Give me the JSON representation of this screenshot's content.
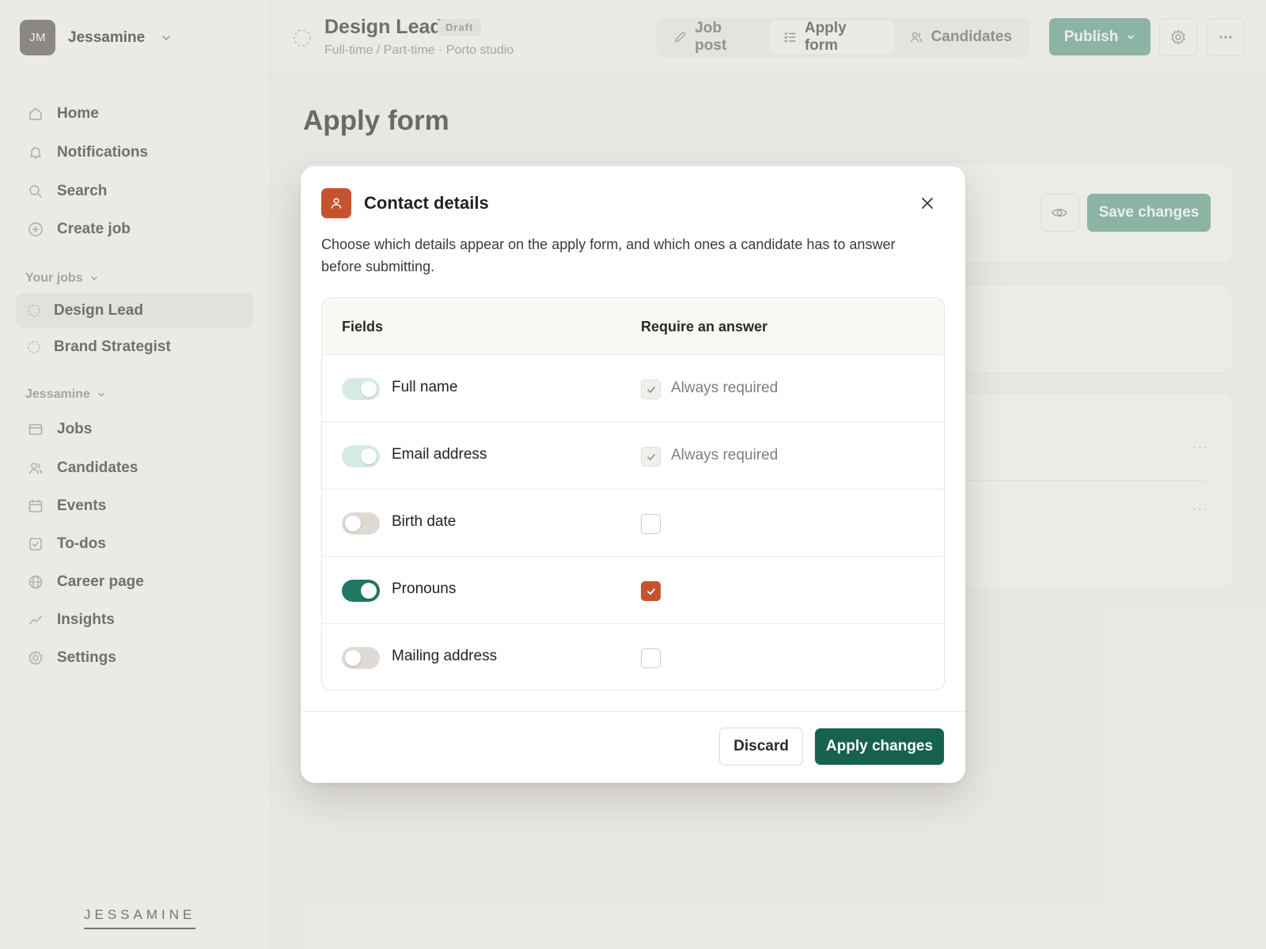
{
  "sidebar": {
    "account": {
      "initials": "JM",
      "name": "Jessamine"
    },
    "nav": [
      {
        "label": "Home",
        "icon": "home-icon"
      },
      {
        "label": "Notifications",
        "icon": "bell-icon"
      },
      {
        "label": "Search",
        "icon": "search-icon"
      },
      {
        "label": "Create job",
        "icon": "plus-circle-icon"
      }
    ],
    "your_jobs_label": "Your jobs",
    "jobs": [
      {
        "label": "Design Lead",
        "active": true
      },
      {
        "label": "Brand Strategist",
        "active": false
      }
    ],
    "workspace_label": "Jessamine",
    "workspace_nav": [
      {
        "label": "Jobs",
        "icon": "briefcase-icon"
      },
      {
        "label": "Candidates",
        "icon": "people-icon"
      },
      {
        "label": "Events",
        "icon": "calendar-icon"
      },
      {
        "label": "To-dos",
        "icon": "checklist-icon"
      },
      {
        "label": "Career page",
        "icon": "globe-icon"
      },
      {
        "label": "Insights",
        "icon": "chart-line-icon"
      },
      {
        "label": "Settings",
        "icon": "gear-icon"
      }
    ],
    "brand": "JESSAMINE"
  },
  "header": {
    "job_title": "Design Lead",
    "badge": "Draft",
    "subtitle": "Full-time / Part-time · Porto studio",
    "tabs": [
      {
        "label": "Job post",
        "icon": "pencil-icon",
        "active": false
      },
      {
        "label": "Apply form",
        "icon": "list-icon",
        "active": true
      },
      {
        "label": "Candidates",
        "icon": "people-icon",
        "active": false
      }
    ],
    "publish_label": "Publish"
  },
  "main": {
    "page_title": "Apply form",
    "save_label": "Save changes"
  },
  "modal": {
    "title": "Contact details",
    "description": "Choose which details appear on the apply form, and which ones a candidate has to answer before submitting.",
    "columns": {
      "fields": "Fields",
      "require": "Require an answer"
    },
    "rows": [
      {
        "label": "Full name",
        "toggle": "locked",
        "required": "locked",
        "required_label": "Always required"
      },
      {
        "label": "Email address",
        "toggle": "locked",
        "required": "locked",
        "required_label": "Always required"
      },
      {
        "label": "Birth date",
        "toggle": "off",
        "required": "off",
        "required_label": ""
      },
      {
        "label": "Pronouns",
        "toggle": "on",
        "required": "on",
        "required_label": ""
      },
      {
        "label": "Mailing address",
        "toggle": "off",
        "required": "off",
        "required_label": ""
      }
    ],
    "discard_label": "Discard",
    "apply_label": "Apply changes"
  },
  "colors": {
    "accent_green": "#17614f",
    "toggle_on": "#1f7863",
    "checkbox_on": "#c65330",
    "publish_green": "#5fa38e"
  }
}
